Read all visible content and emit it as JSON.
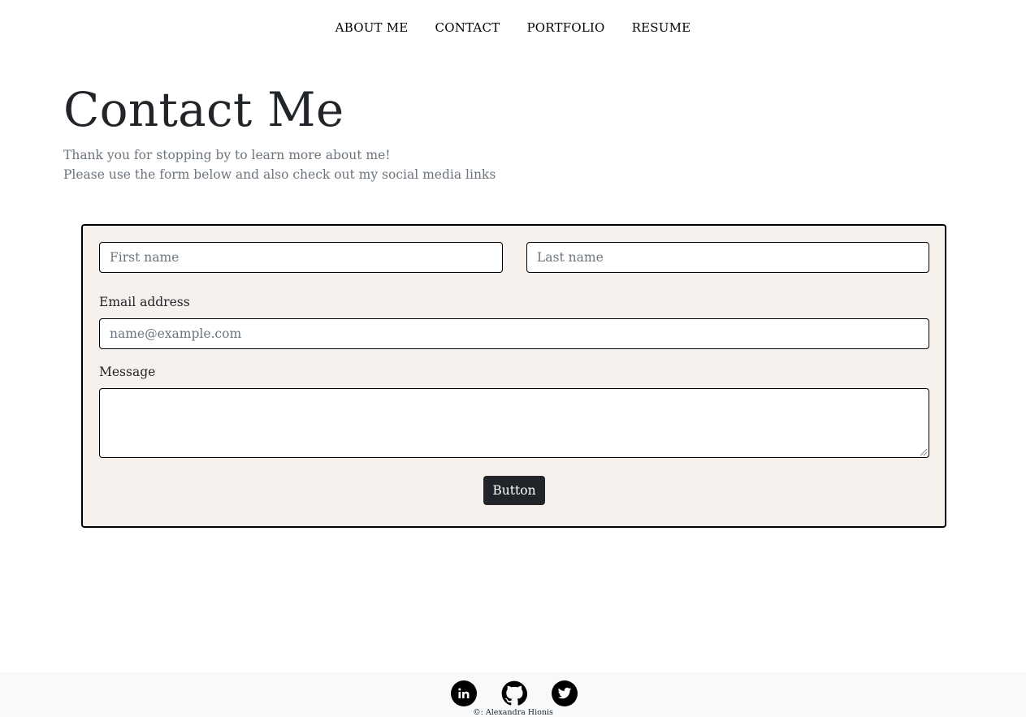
{
  "nav": {
    "items": [
      {
        "label": "ABOUT ME"
      },
      {
        "label": "CONTACT"
      },
      {
        "label": "PORTFOLIO"
      },
      {
        "label": "RESUME"
      }
    ]
  },
  "header": {
    "title": "Contact Me",
    "intro_line1": "Thank you for stopping by to learn more about me!",
    "intro_line2": "Please use the form below and also check out my social media links"
  },
  "form": {
    "first_name_placeholder": "First name",
    "last_name_placeholder": "Last name",
    "email_label": "Email address",
    "email_placeholder": "name@example.com",
    "message_label": "Message",
    "message_value": "",
    "submit_label": "Button"
  },
  "footer": {
    "icons": [
      "linkedin-icon",
      "github-icon",
      "twitter-icon"
    ],
    "copyright": "©: Alexandra Hionis"
  },
  "colors": {
    "form_background": "#f6f1ed",
    "button_background": "#212529",
    "footer_background": "#f8f9fa",
    "muted_text": "#6c757d"
  }
}
